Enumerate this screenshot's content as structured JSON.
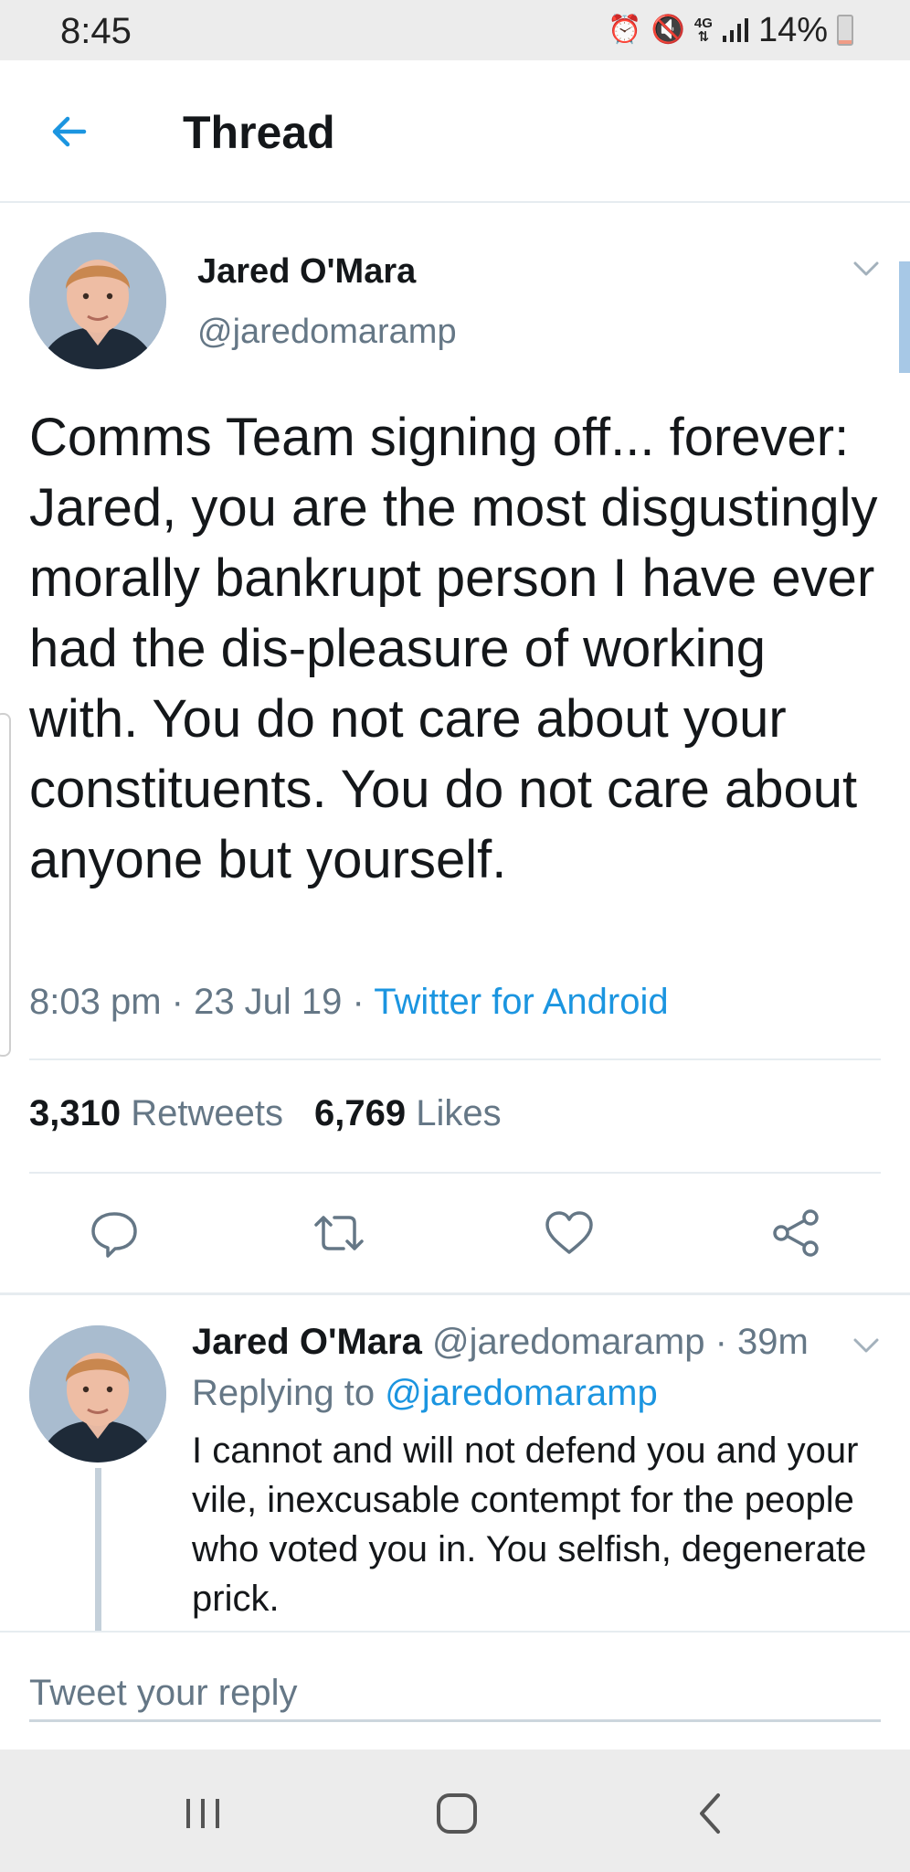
{
  "status_bar": {
    "time": "8:45",
    "network": "4G",
    "battery_percent": "14%",
    "battery_level": 0.14
  },
  "header": {
    "title": "Thread"
  },
  "tweet": {
    "author_name": "Jared O'Mara",
    "author_handle": "@jaredomaramp",
    "text": "Comms Team signing off... forever: Jared, you are the most disgustingly morally bankrupt person I have ever had the dis-pleasure of working with. You do not care about your constituents. You do not care about anyone but yourself.",
    "time": "8:03 pm",
    "date": "23 Jul 19",
    "separator": " · ",
    "source": "Twitter for Android",
    "retweets_count": "3,310",
    "retweets_label": "Retweets",
    "likes_count": "6,769",
    "likes_label": "Likes"
  },
  "reply": {
    "author_name": "Jared O'Mara",
    "author_handle": "@jaredomaramp",
    "age": "39m",
    "replying_prefix": "Replying to",
    "replying_to": "@jaredomaramp",
    "text": "I cannot and will not defend you and your vile, inexcusable contempt for the people who voted you in. You selfish, degenerate prick."
  },
  "compose": {
    "placeholder": "Tweet your reply"
  },
  "colors": {
    "accent": "#1b95e0",
    "secondary_text": "#657786",
    "primary_text": "#14171a",
    "divider": "#e6ecf0"
  },
  "icons": {
    "back": "arrow-left-icon",
    "caret": "chevron-down-icon",
    "reply": "speech-bubble-icon",
    "retweet": "retweet-icon",
    "like": "heart-icon",
    "share": "share-icon",
    "nav_recents": "recents-icon",
    "nav_home": "home-icon",
    "nav_back": "nav-back-icon"
  }
}
